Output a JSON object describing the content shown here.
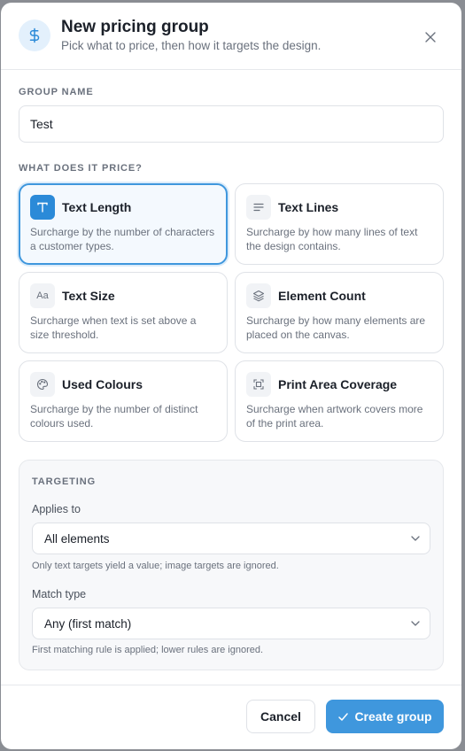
{
  "header": {
    "icon": "dollar-icon",
    "title": "New pricing group",
    "subtitle": "Pick what to price, then how it targets the design."
  },
  "group_name": {
    "label": "GROUP NAME",
    "value": "Test"
  },
  "price_section": {
    "label": "WHAT DOES IT PRICE?",
    "options": [
      {
        "title": "Text Length",
        "desc": "Surcharge by the number of characters a customer types.",
        "icon": "text-t-icon",
        "selected": true
      },
      {
        "title": "Text Lines",
        "desc": "Surcharge by how many lines of text the design contains.",
        "icon": "lines-icon",
        "selected": false
      },
      {
        "title": "Text Size",
        "desc": "Surcharge when text is set above a size threshold.",
        "icon": "font-size-icon",
        "icon_text": "Aa",
        "selected": false
      },
      {
        "title": "Element Count",
        "desc": "Surcharge by how many elements are placed on the canvas.",
        "icon": "layers-icon",
        "selected": false
      },
      {
        "title": "Used Colours",
        "desc": "Surcharge by the number of distinct colours used.",
        "icon": "palette-icon",
        "selected": false
      },
      {
        "title": "Print Area Coverage",
        "desc": "Surcharge when artwork covers more of the print area.",
        "icon": "frame-icon",
        "selected": false
      }
    ]
  },
  "targeting": {
    "label": "TARGETING",
    "applies_to_label": "Applies to",
    "applies_to_value": "All elements",
    "applies_to_hint": "Only text targets yield a value; image targets are ignored.",
    "match_type_label": "Match type",
    "match_type_value": "Any (first match)",
    "match_type_hint": "First matching rule is applied; lower rules are ignored."
  },
  "footer": {
    "cancel_label": "Cancel",
    "create_label": "Create group"
  },
  "colors": {
    "accent": "#3f97dd",
    "accent_light": "#e3f0fc",
    "overlay": "#8a8d93"
  }
}
